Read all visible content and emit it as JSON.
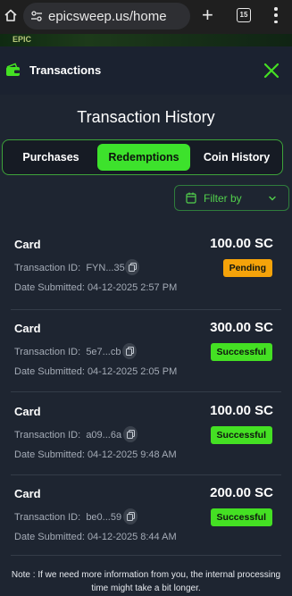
{
  "browser": {
    "url": "epicsweep.us/home",
    "tab_count": "15"
  },
  "background": {
    "strip_text": "EPIC"
  },
  "modal": {
    "header_title": "Transactions",
    "page_title": "Transaction History",
    "tabs": [
      {
        "label": "Purchases",
        "active": false
      },
      {
        "label": "Redemptions",
        "active": true
      },
      {
        "label": "Coin History",
        "active": false
      }
    ],
    "filter_label": "Filter by",
    "transactions": [
      {
        "type": "Card",
        "amount": "100.00 SC",
        "id_label": "Transaction ID:",
        "id_value": "FYN...35",
        "date_label": "Date Submitted:",
        "date_value": "04-12-2025 2:57 PM",
        "status": "Pending"
      },
      {
        "type": "Card",
        "amount": "300.00 SC",
        "id_label": "Transaction ID:",
        "id_value": "5e7...cb",
        "date_label": "Date Submitted:",
        "date_value": "04-12-2025 2:05 PM",
        "status": "Successful"
      },
      {
        "type": "Card",
        "amount": "100.00 SC",
        "id_label": "Transaction ID:",
        "id_value": "a09...6a",
        "date_label": "Date Submitted:",
        "date_value": "04-12-2025 9:48 AM",
        "status": "Successful"
      },
      {
        "type": "Card",
        "amount": "200.00 SC",
        "id_label": "Transaction ID:",
        "id_value": "be0...59",
        "date_label": "Date Submitted:",
        "date_value": "04-12-2025 8:44 AM",
        "status": "Successful"
      }
    ],
    "note": "Note : If we need more information from you, the internal processing time might take a bit longer."
  },
  "colors": {
    "accent_green": "#3de22c",
    "pending_orange": "#f5a30a",
    "success_green": "#44e023",
    "panel_bg": "#1e2531"
  },
  "icons": [
    "home-icon",
    "tune-icon",
    "plus-icon",
    "tabs-icon",
    "more-vert-icon",
    "wallet-icon",
    "close-icon",
    "calendar-icon",
    "chevron-down-icon",
    "copy-icon"
  ]
}
